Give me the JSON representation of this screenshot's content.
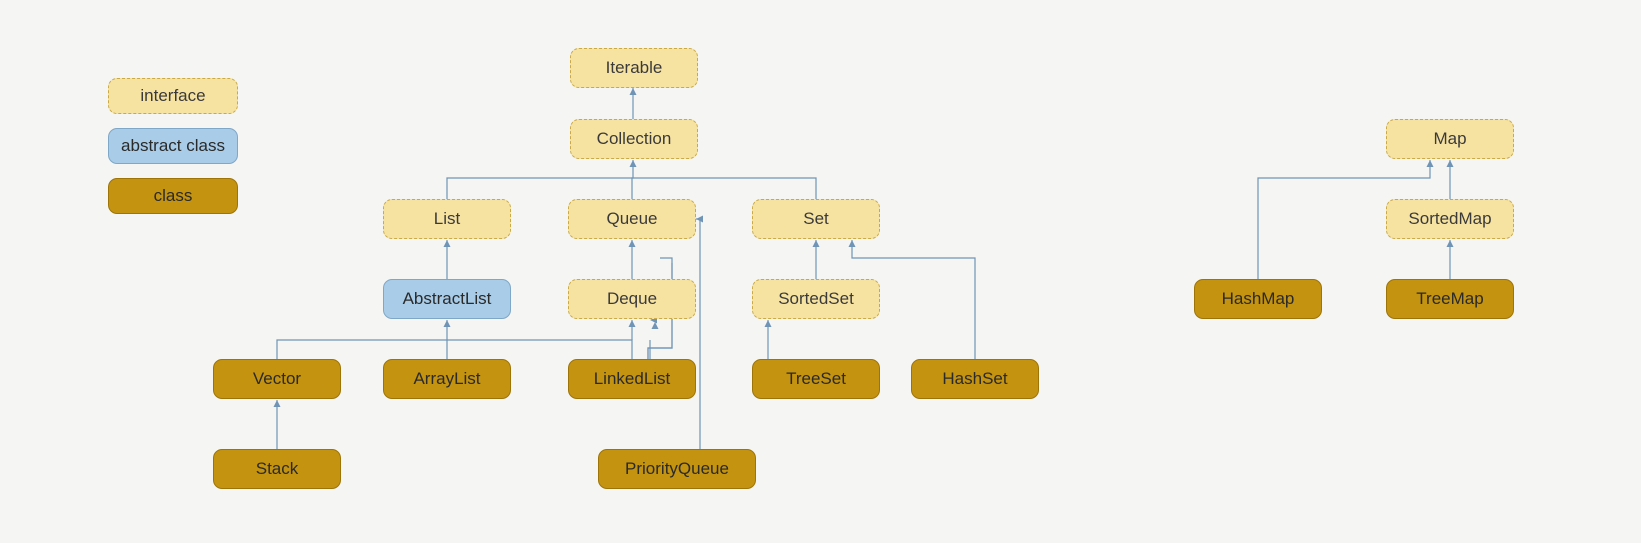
{
  "legend": {
    "interface": "interface",
    "abstract": "abstract class",
    "class": "class"
  },
  "nodes": {
    "iterable": "Iterable",
    "collection": "Collection",
    "list": "List",
    "queue": "Queue",
    "set": "Set",
    "abstractlist": "AbstractList",
    "deque": "Deque",
    "sortedset": "SortedSet",
    "vector": "Vector",
    "arraylist": "ArrayList",
    "linkedlist": "LinkedList",
    "treeset": "TreeSet",
    "hashset": "HashSet",
    "stack": "Stack",
    "priorityqueue": "PriorityQueue",
    "map": "Map",
    "sortedmap": "SortedMap",
    "hashmap": "HashMap",
    "treemap": "TreeMap"
  },
  "colors": {
    "interface_fill": "#f7e3a1",
    "interface_border": "#c9aa4a",
    "abstract_fill": "#a9cce8",
    "abstract_border": "#7fa7c7",
    "class_fill": "#c49310",
    "class_border": "#9e7407",
    "arrow": "#6f94b6"
  }
}
